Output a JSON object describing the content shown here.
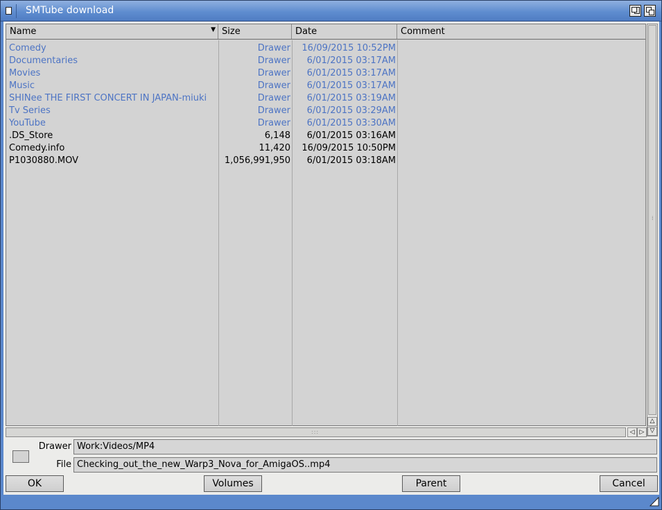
{
  "window": {
    "title": "SMTube download",
    "icons": [
      "close-icon",
      "zoom-icon",
      "depth-icon",
      "resize-icon"
    ]
  },
  "list": {
    "columns": [
      "Name",
      "Size",
      "Date",
      "Comment"
    ],
    "sort_indicator": "▼",
    "rows": [
      {
        "name": "Comedy",
        "size": "Drawer",
        "date": "16/09/2015 10:52PM",
        "comment": "",
        "drawer": true
      },
      {
        "name": "Documentaries",
        "size": "Drawer",
        "date": "6/01/2015 03:17AM",
        "comment": "",
        "drawer": true
      },
      {
        "name": "Movies",
        "size": "Drawer",
        "date": "6/01/2015 03:17AM",
        "comment": "",
        "drawer": true
      },
      {
        "name": "Music",
        "size": "Drawer",
        "date": "6/01/2015 03:17AM",
        "comment": "",
        "drawer": true
      },
      {
        "name": "SHINee THE FIRST CONCERT IN JAPAN-miuki",
        "size": "Drawer",
        "date": "6/01/2015 03:19AM",
        "comment": "",
        "drawer": true
      },
      {
        "name": "Tv Series",
        "size": "Drawer",
        "date": "6/01/2015 03:29AM",
        "comment": "",
        "drawer": true
      },
      {
        "name": "YouTube",
        "size": "Drawer",
        "date": "6/01/2015 03:30AM",
        "comment": "",
        "drawer": true
      },
      {
        "name": ".DS_Store",
        "size": "6,148",
        "date": "6/01/2015 03:16AM",
        "comment": "",
        "drawer": false
      },
      {
        "name": "Comedy.info",
        "size": "11,420",
        "date": "16/09/2015 10:50PM",
        "comment": "",
        "drawer": false
      },
      {
        "name": "P1030880.MOV",
        "size": "1,056,991,950",
        "date": "6/01/2015 03:18AM",
        "comment": "",
        "drawer": false
      }
    ]
  },
  "fields": {
    "drawer_label": "Drawer",
    "drawer_value": "Work:Videos/MP4",
    "file_label": "File",
    "file_value": "Checking_out_the_new_Warp3_Nova_for_AmigaOS..mp4"
  },
  "buttons": {
    "ok": "OK",
    "volumes": "Volumes",
    "parent": "Parent",
    "cancel": "Cancel"
  },
  "scroll": {
    "up_arrow": "△",
    "down_arrow": "▽",
    "left_arrow": "◁",
    "right_arrow": "▷",
    "grip_h": ":::",
    "grip_v": "⁞"
  },
  "colors": {
    "drawer_text": "#4d74c4",
    "title_bar": "#5f8dd0",
    "list_bg": "#d3d3d3"
  }
}
